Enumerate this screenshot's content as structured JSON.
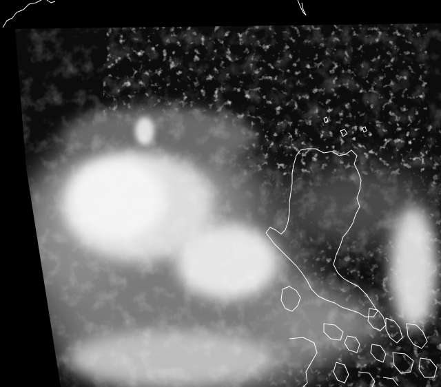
{
  "image": {
    "kind": "satellite-infrared-image",
    "palette": {
      "background": "#000000",
      "swath": "#0c0c0c",
      "cloud_bright": "#f4f4f4",
      "cloud_mid": "#a8a8a8",
      "cloud_dim": "#5a5a5a",
      "coastline": "#ffffff"
    }
  }
}
